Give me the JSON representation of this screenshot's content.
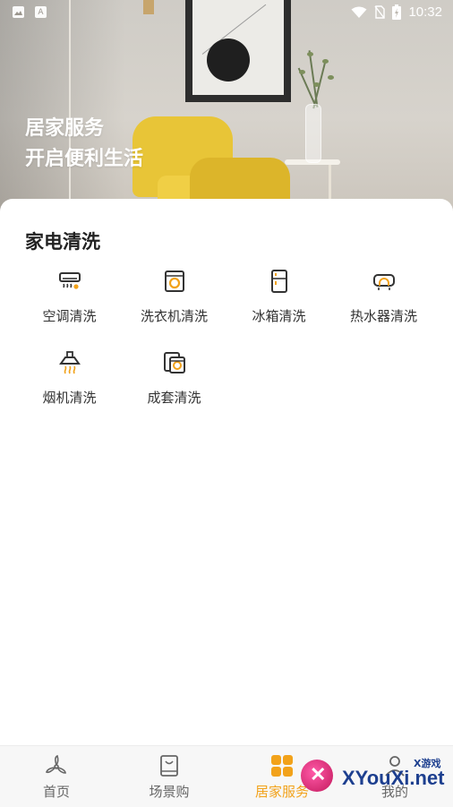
{
  "status_bar": {
    "time": "10:32",
    "left_icons": [
      "image-icon",
      "a-letter-icon"
    ],
    "right_icons": [
      "wifi-icon",
      "no-sim-icon",
      "battery-charging-icon"
    ]
  },
  "hero": {
    "title_line1": "居家服务",
    "title_line2": "开启便利生活"
  },
  "section": {
    "title": "家电清洗",
    "items": [
      {
        "label": "空调清洗",
        "icon": "air-conditioner-icon"
      },
      {
        "label": "洗衣机清洗",
        "icon": "washing-machine-icon"
      },
      {
        "label": "冰箱清洗",
        "icon": "refrigerator-icon"
      },
      {
        "label": "热水器清洗",
        "icon": "water-heater-icon"
      },
      {
        "label": "烟机清洗",
        "icon": "range-hood-icon"
      },
      {
        "label": "成套清洗",
        "icon": "package-clean-icon"
      }
    ]
  },
  "tabbar": {
    "tabs": [
      {
        "label": "首页",
        "icon": "home-fan-icon",
        "active": false
      },
      {
        "label": "场景购",
        "icon": "scene-book-icon",
        "active": false
      },
      {
        "label": "居家服务",
        "icon": "grid-four-icon",
        "active": true
      },
      {
        "label": "我的",
        "icon": "profile-icon",
        "active": false
      }
    ]
  },
  "colors": {
    "accent": "#f2a21a",
    "icon_stroke": "#333333",
    "inactive_tab": "#666666"
  },
  "watermark": {
    "brand": "XYouXi.net",
    "small": "X游戏"
  }
}
